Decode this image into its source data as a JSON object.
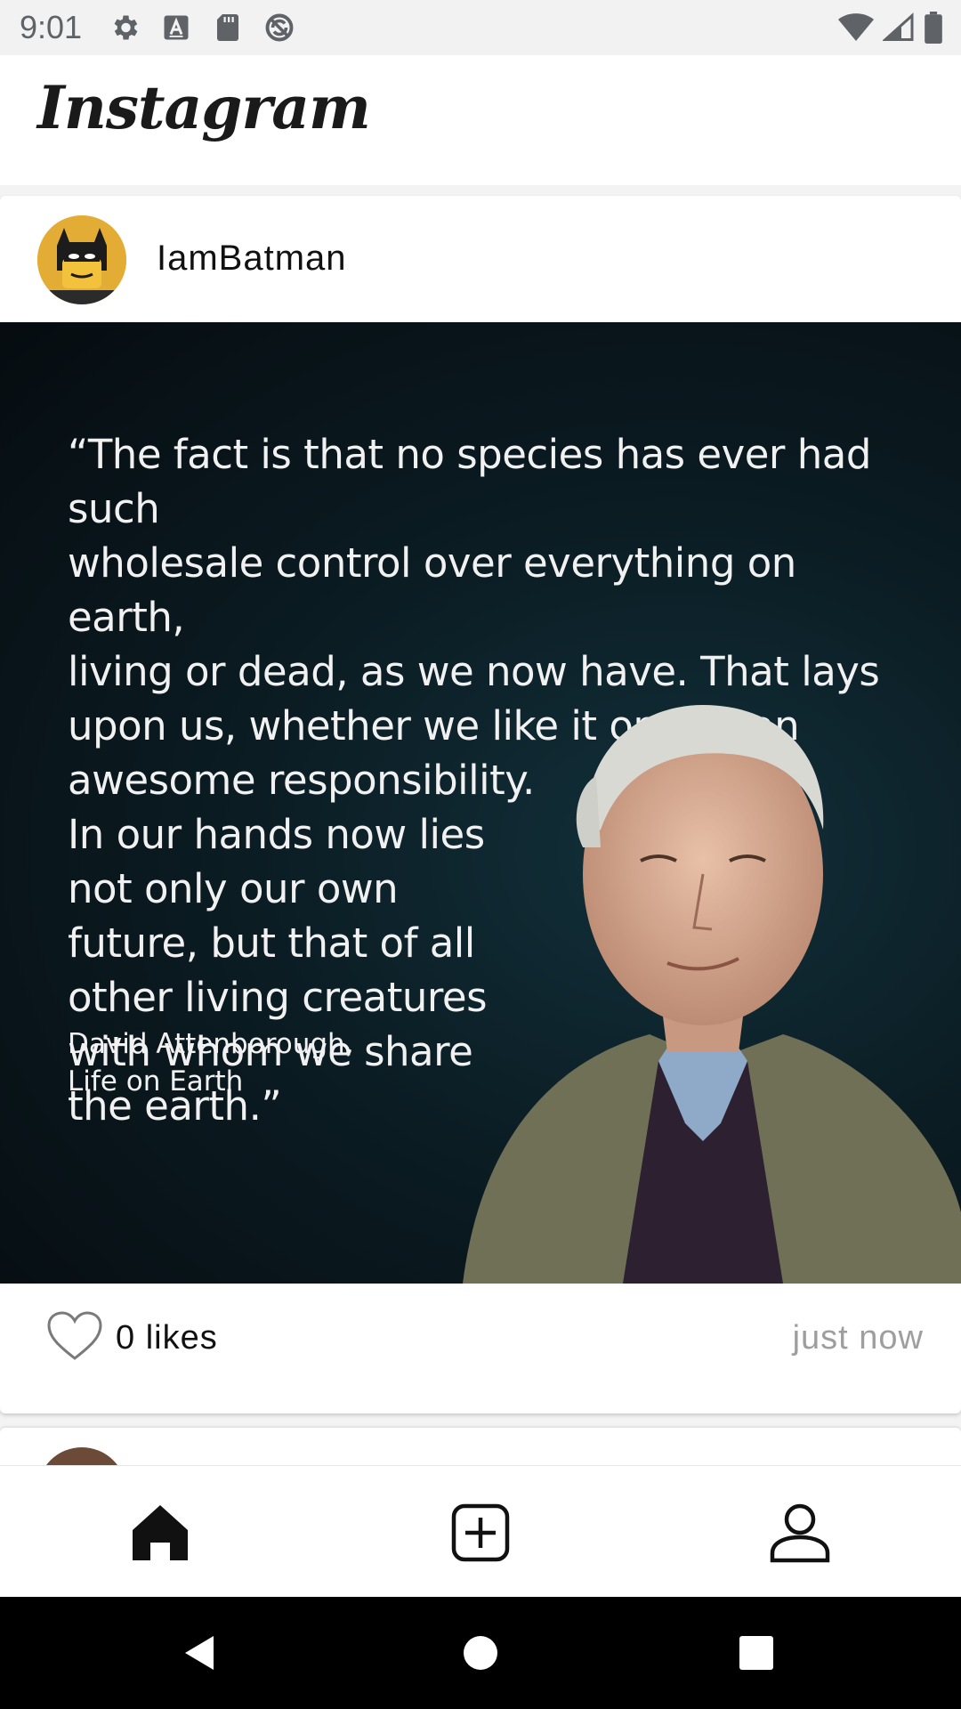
{
  "status_bar": {
    "time": "9:01",
    "left_icons": [
      "gear-icon",
      "a-box-icon",
      "sd-card-icon",
      "sync-icon"
    ],
    "right_icons": [
      "wifi-icon",
      "cell-signal-icon",
      "battery-icon"
    ]
  },
  "app_bar": {
    "title": "Instagram"
  },
  "post": {
    "username": "IamBatman",
    "avatar": "batman-lego-avatar",
    "image": {
      "quote": "“The fact is that no species has ever had such\nwholesale control over everything on earth,\nliving or dead, as we now have. That lays\nupon us, whether we like it or not, an\nawesome responsibility.\nIn our hands now lies\nnot only our own\nfuture, but that of all\nother living creatures\nwith whom we share\nthe earth.”",
      "attribution": "David Attenborough,\nLife on Earth"
    },
    "likes_label": "0 likes",
    "timestamp": "just now"
  },
  "bottom_nav": {
    "items": [
      "home-icon",
      "add-post-icon",
      "profile-icon"
    ],
    "active": "home-icon"
  },
  "system_nav": {
    "buttons": [
      "back-icon",
      "home-circle-icon",
      "recents-icon"
    ]
  },
  "colors": {
    "accent": "#1a1a1a",
    "timestamp": "#9e9e9e",
    "image_bg": "#0b1c23"
  }
}
